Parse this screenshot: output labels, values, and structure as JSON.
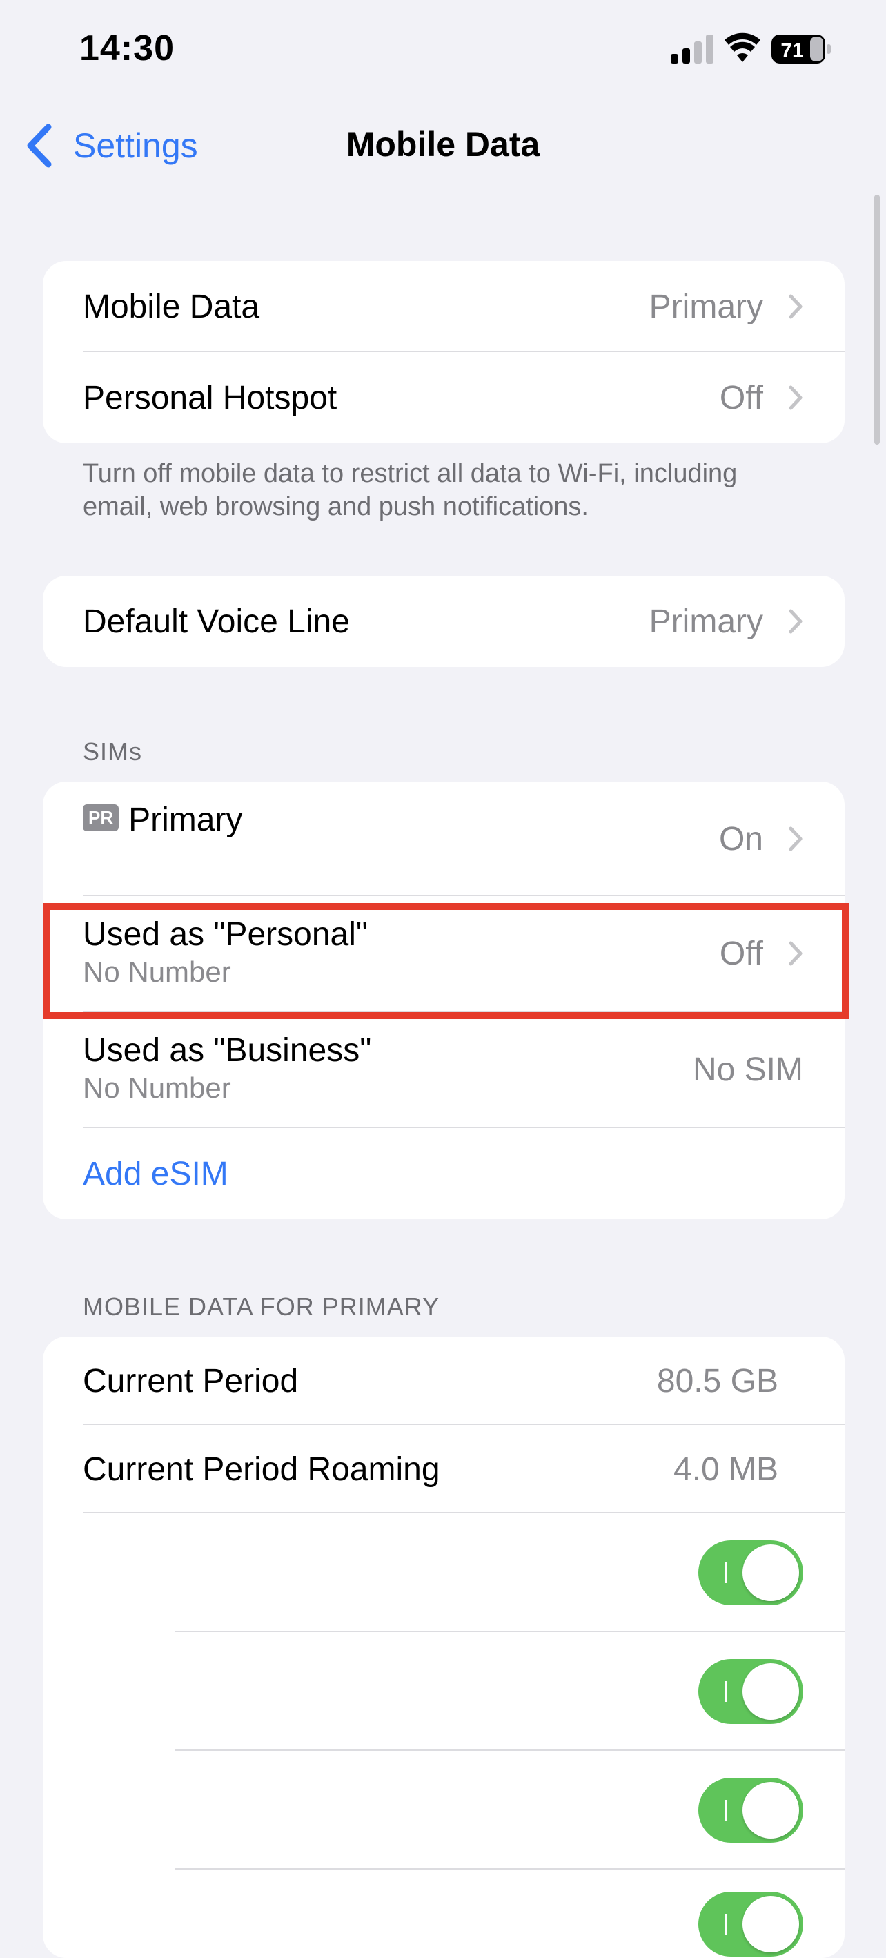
{
  "status_bar": {
    "time": "14:30",
    "battery": "71"
  },
  "nav": {
    "back_label": "Settings",
    "title": "Mobile Data"
  },
  "group1": {
    "rows": [
      {
        "label": "Mobile Data",
        "value": "Primary"
      },
      {
        "label": "Personal Hotspot",
        "value": "Off"
      }
    ],
    "footer": "Turn off mobile data to restrict all data to Wi-Fi, including email, web browsing and push notifications."
  },
  "group2": {
    "rows": [
      {
        "label": "Default Voice Line",
        "value": "Primary"
      }
    ]
  },
  "sims": {
    "header": "SIMs",
    "primary": {
      "badge": "PR",
      "label": "Primary",
      "value": "On"
    },
    "personal": {
      "label": "Used as \"Personal\"",
      "sub": "No Number",
      "value": "Off"
    },
    "business": {
      "label": "Used as \"Business\"",
      "sub": "No Number",
      "value": "No SIM"
    },
    "add_esim": "Add eSIM"
  },
  "usage": {
    "header": "MOBILE DATA FOR PRIMARY",
    "current_period": {
      "label": "Current Period",
      "value": "80.5 GB"
    },
    "roaming": {
      "label": "Current Period Roaming",
      "value": "4.0 MB"
    },
    "toggles": [
      true,
      true,
      true,
      true
    ]
  },
  "colors": {
    "accent": "#3478f6",
    "toggle_on": "#5fc45a",
    "highlight": "#e53b2b"
  }
}
